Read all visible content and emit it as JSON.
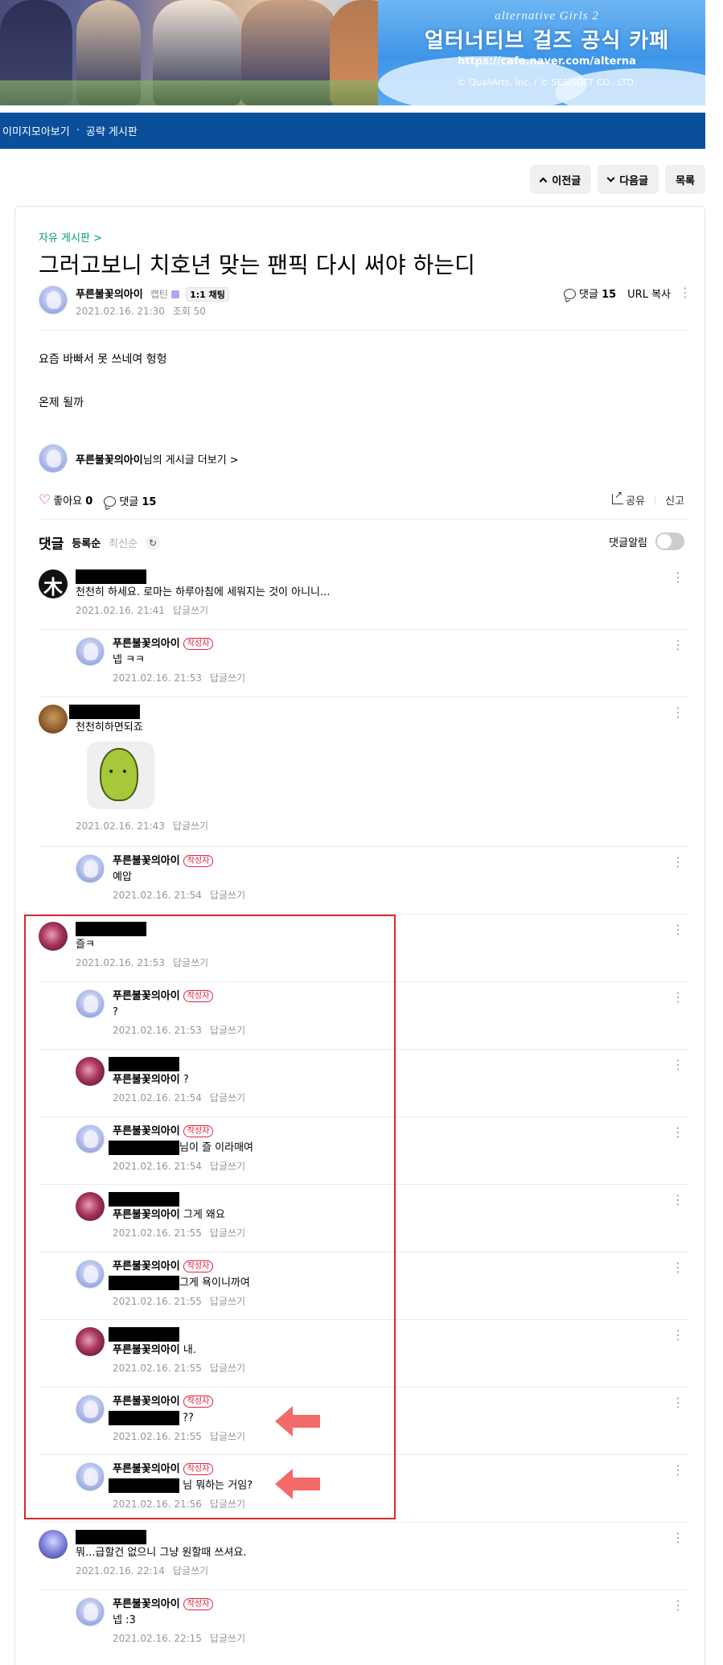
{
  "banner": {
    "game_title": "alternative Girls 2",
    "cafe_title": "얼터너티브 걸즈 공식 카페",
    "url": "https://cafe.naver.com/alterna",
    "copyright": "© QualiArts, Inc. / © SESISOFT CO., LTD."
  },
  "nav": {
    "item1": "이미지모아보기",
    "sep": "·",
    "item2": "공략 게시판"
  },
  "top_buttons": {
    "prev": "이전글",
    "next": "다음글",
    "list": "목록"
  },
  "post": {
    "board": "자유 게시판 >",
    "title": "그러고보니 치호년 맞는 팬픽 다시 써야 하는디",
    "author": "푸른불꽃의아이",
    "rank": "캡틴",
    "chat": "1:1 채팅",
    "date": "2021.02.16. 21:30",
    "views_label": "조회",
    "views": "50",
    "comment_label": "댓글",
    "comment_count": "15",
    "url_copy": "URL 복사",
    "body_line1": "요즘 바빠서 못 쓰네여 헝헝",
    "body_line2": "온제 될까",
    "more_author": "푸른불꽃의아이",
    "more_suffix": "님의 게시글 더보기 >",
    "like_label": "좋아요",
    "like_count": "0",
    "share": "공유",
    "report": "신고"
  },
  "comments_header": {
    "title": "댓글",
    "sort_registered": "등록순",
    "sort_latest": "최신순",
    "alarm": "댓글알림"
  },
  "writer_badge": "작성자",
  "reply_label": "답글쓰기",
  "comments": [
    {
      "name": "",
      "text": "천천히 하세요. 로마는 하루아침에 세워지는 것이 아니니...",
      "date": "2021.02.16. 21:41"
    },
    {
      "name": "푸른불꽃의아이",
      "text": "넵 ㅋㅋ",
      "date": "2021.02.16. 21:53"
    },
    {
      "name": "",
      "text": "천천히하면되죠",
      "date": "2021.02.16. 21:43"
    },
    {
      "name": "푸른불꽃의아이",
      "text": "예압",
      "date": "2021.02.16. 21:54"
    },
    {
      "name": "",
      "text": "즐ㅋ",
      "date": "2021.02.16. 21:53"
    },
    {
      "name": "푸른불꽃의아이",
      "text": "?",
      "date": "2021.02.16. 21:53"
    },
    {
      "name": "",
      "mention": "푸른불꽃의아이",
      "text": "?",
      "date": "2021.02.16. 21:54"
    },
    {
      "name": "푸른불꽃의아이",
      "text": "님이 즐 이라매여",
      "date": "2021.02.16. 21:54"
    },
    {
      "name": "",
      "mention": "푸른불꽃의아이",
      "text": "그게 왜요",
      "date": "2021.02.16. 21:55"
    },
    {
      "name": "푸른불꽃의아이",
      "text": "그게 욕이니까여",
      "date": "2021.02.16. 21:55"
    },
    {
      "name": "",
      "mention": "푸른불꽃의아이",
      "text": "내.",
      "date": "2021.02.16. 21:55"
    },
    {
      "name": "푸른불꽃의아이",
      "text": "??",
      "date": "2021.02.16. 21:55"
    },
    {
      "name": "푸른불꽃의아이",
      "text": "님 뭐하는 거임?",
      "date": "2021.02.16. 21:56"
    },
    {
      "name": "",
      "text": "뭐...급할건 없으니 그냥 원할때 쓰셔요.",
      "date": "2021.02.16. 22:14"
    },
    {
      "name": "푸른불꽃의아이",
      "text": "넵 :3",
      "date": "2021.02.16. 22:15"
    }
  ],
  "colors": {
    "nav": "#0a4f9c",
    "board_link": "#03a066",
    "highlight": "#d62a2a",
    "arrow": "#f26a6a",
    "heart": "#e0223d"
  },
  "icons": [
    "chevron-up-icon",
    "chevron-down-icon",
    "comment-bubble-icon",
    "more-kebab-icon",
    "heart-icon",
    "share-icon",
    "refresh-icon",
    "toggle-switch",
    "arrow-left-icon"
  ]
}
